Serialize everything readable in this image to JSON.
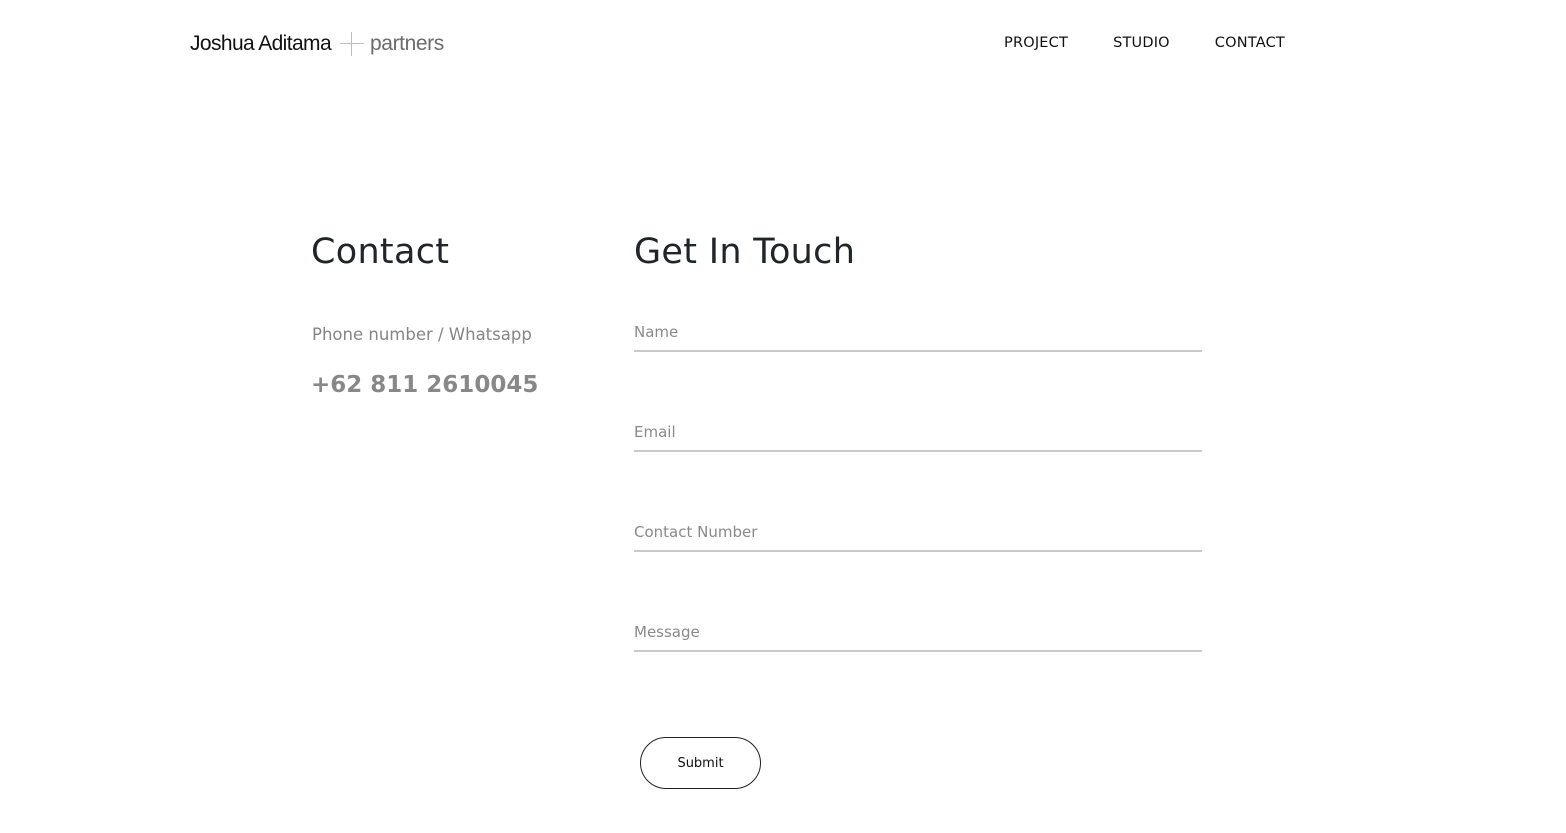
{
  "header": {
    "logo_name": "Joshua Aditama",
    "logo_partners": "partners",
    "nav": [
      "PROJECT",
      "STUDIO",
      "CONTACT"
    ]
  },
  "contact": {
    "title": "Contact",
    "phone_label": "Phone number / Whatsapp",
    "phone_value": "+62 811 2610045"
  },
  "form": {
    "title": "Get In Touch",
    "fields": {
      "name_placeholder": "Name",
      "email_placeholder": "Email",
      "contact_placeholder": "Contact Number",
      "message_placeholder": "Message"
    },
    "submit_label": "Submit"
  },
  "colors": {
    "text_dark": "#212529",
    "text_muted": "#888888",
    "underline": "#c9c9c9"
  }
}
